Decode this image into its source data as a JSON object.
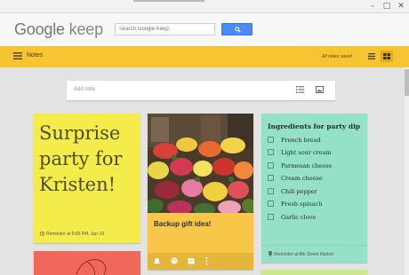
{
  "header": {
    "logo_google": "Google",
    "logo_keep": "keep",
    "search_placeholder": "Search Google Keep"
  },
  "toolbar": {
    "title": "Notes",
    "saved_status": "All notes saved"
  },
  "add_note": {
    "placeholder": "Add note"
  },
  "notes": {
    "yellow": {
      "text": "Surprise party for Kristen!",
      "reminder": "Reminder at 5:00 PM, Jun 19",
      "color": "#f4ec4a"
    },
    "photo": {
      "caption": "Backup gift idea!",
      "color": "#f8c74a"
    },
    "checklist": {
      "title": "Ingredients for party dip",
      "items": [
        "French bread",
        "Light sour cream",
        "Parmesan cheese",
        "Cream cheese",
        "Chili pepper",
        "Fresh spinach",
        "Garlic clove"
      ],
      "reminder": "Reminder at 8th Street Market",
      "color": "#95e0c8"
    }
  },
  "colors": {
    "accent_yellow": "#f7c532",
    "search_blue": "#4a8af4",
    "note_red": "#f0685a",
    "note_green": "#cde88e"
  },
  "icons": {
    "menu": "menu-icon",
    "search": "search-icon",
    "list_view": "list-view-icon",
    "grid_view": "grid-view-icon",
    "checklist": "checklist-icon",
    "image": "image-icon",
    "clock": "clock-icon",
    "location": "location-icon"
  }
}
